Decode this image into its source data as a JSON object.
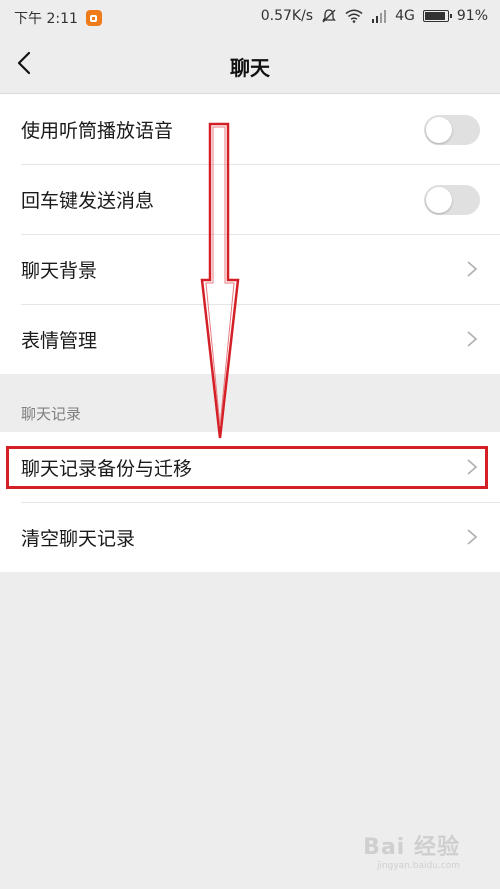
{
  "status_bar": {
    "time": "下午 2:11",
    "speed": "0.57K/s",
    "network": "4G",
    "battery": "91%",
    "icons": [
      "app-notification-icon",
      "mute-icon",
      "wifi-icon",
      "signal-icon",
      "battery-icon"
    ]
  },
  "nav": {
    "title": "聊天",
    "back_icon": "back-chevron-icon"
  },
  "settings_group1": [
    {
      "label": "使用听筒播放语音",
      "control": "toggle",
      "on": false
    },
    {
      "label": "回车键发送消息",
      "control": "toggle",
      "on": false
    },
    {
      "label": "聊天背景",
      "control": "chevron"
    },
    {
      "label": "表情管理",
      "control": "chevron"
    }
  ],
  "section_header": "聊天记录",
  "settings_group2": [
    {
      "label": "聊天记录备份与迁移",
      "control": "chevron",
      "highlighted": true
    },
    {
      "label": "清空聊天记录",
      "control": "chevron"
    }
  ],
  "annotation": {
    "arrow_color": "#d51f26",
    "highlight_color": "#d51f26"
  },
  "watermark": {
    "main": "Bai 经验",
    "sub": "jingyan.baidu.com"
  }
}
